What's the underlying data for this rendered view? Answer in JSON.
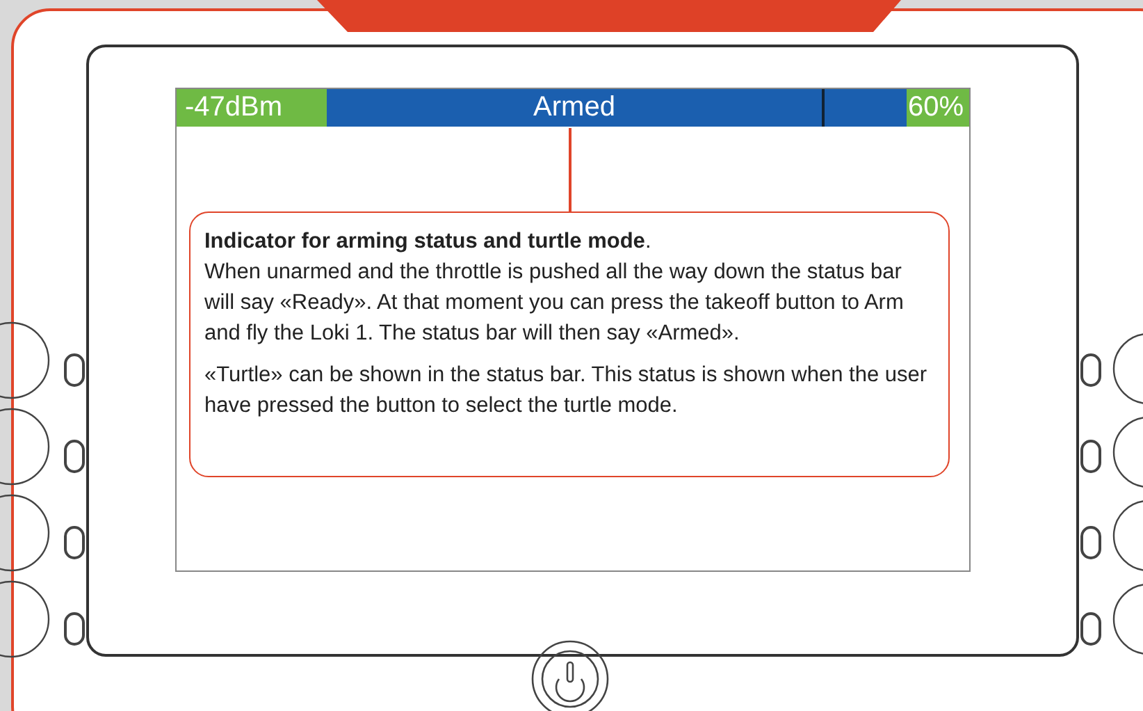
{
  "status_bar": {
    "signal": "-47dBm",
    "status": "Armed",
    "battery": "60%"
  },
  "callout": {
    "title": "**Indicator for arming status and turtle mode**.",
    "paragraphs": [
      "When unarmed and the throttle is pushed all the way down the status bar will say «Ready». At that moment you can press the takeoff button to Arm and fly the Loki 1. The status bar will then say «Armed».",
      "«Turtle» can be shown in the status bar. This status is shown when the user have pressed the button to select the turtle mode."
    ]
  }
}
